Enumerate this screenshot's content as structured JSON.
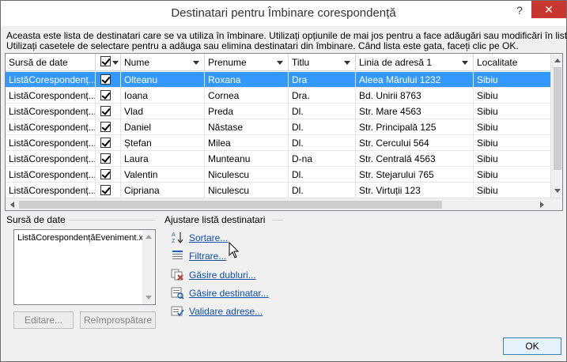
{
  "window": {
    "title": "Destinatari pentru Îmbinare corespondență",
    "help_label": "?",
    "close_label": "✕"
  },
  "description": {
    "line1": "Aceasta este lista de destinatari care se va utiliza în îmbinare. Utilizați opțiunile de mai jos pentru a face adăugări sau modificări în listă.",
    "line2": "Utilizați casetele de selectare pentru a adăuga sau elimina destinatari din îmbinare. Când lista este gata, faceți clic pe OK."
  },
  "grid": {
    "columns": [
      "Sursă de date",
      "",
      "Nume",
      "Prenume",
      "Titlu",
      "Linia de adresă 1",
      "Localitate"
    ],
    "rows": [
      {
        "source": "ListăCorespondenț...",
        "checked": true,
        "nume": "Olteanu",
        "prenume": "Roxana",
        "titlu": "Dra",
        "adresa": "Aleea Mărului 1232",
        "localitate": "Sibiu",
        "selected": true
      },
      {
        "source": "ListăCorespondenț...",
        "checked": true,
        "nume": "Ioana",
        "prenume": "Cornea",
        "titlu": "Dra.",
        "adresa": "Bd. Unirii 8763",
        "localitate": "Sibiu",
        "selected": false
      },
      {
        "source": "ListăCorespondenț...",
        "checked": true,
        "nume": "Vlad",
        "prenume": "Preda",
        "titlu": "Dl.",
        "adresa": "Str. Mare 4563",
        "localitate": "Sibiu",
        "selected": false
      },
      {
        "source": "ListăCorespondenț...",
        "checked": true,
        "nume": "Daniel",
        "prenume": "Năstase",
        "titlu": "Dl.",
        "adresa": "Str. Principală 125",
        "localitate": "Sibiu",
        "selected": false
      },
      {
        "source": "ListăCorespondenț...",
        "checked": true,
        "nume": "Ștefan",
        "prenume": "Milea",
        "titlu": "Dl.",
        "adresa": "Str. Cercului 564",
        "localitate": "Sibiu",
        "selected": false
      },
      {
        "source": "ListăCorespondenț...",
        "checked": true,
        "nume": "Laura",
        "prenume": "Munteanu",
        "titlu": "D-na",
        "adresa": "Str. Centrală 4563",
        "localitate": "Sibiu",
        "selected": false
      },
      {
        "source": "ListăCorespondenț...",
        "checked": true,
        "nume": "Valentin",
        "prenume": "Niculescu",
        "titlu": "Dl.",
        "adresa": "Str. Stejarului 765",
        "localitate": "Sibiu",
        "selected": false
      },
      {
        "source": "ListăCorespondenț...",
        "checked": true,
        "nume": "Cipriana",
        "prenume": "Niculescu",
        "titlu": "Dl.",
        "adresa": "Str. Virtuții 123",
        "localitate": "Sibiu",
        "selected": false
      }
    ]
  },
  "data_source": {
    "label": "Sursă de date",
    "items": [
      "ListăCorespondențăEveniment.xlsx"
    ],
    "edit_label": "Editare...",
    "refresh_label": "Reîmprospătare"
  },
  "refine": {
    "label": "Ajustare listă destinatari",
    "links": [
      {
        "label": "Sortare...",
        "icon": "sort-az-icon"
      },
      {
        "label": "Filtrare...",
        "icon": "filter-icon"
      },
      {
        "label": "Găsire dubluri...",
        "icon": "find-duplicates-icon"
      },
      {
        "label": "Găsire destinatar...",
        "icon": "find-recipient-icon"
      },
      {
        "label": "Validare adrese...",
        "icon": "validate-addresses-icon"
      }
    ]
  },
  "ok_label": "OK"
}
